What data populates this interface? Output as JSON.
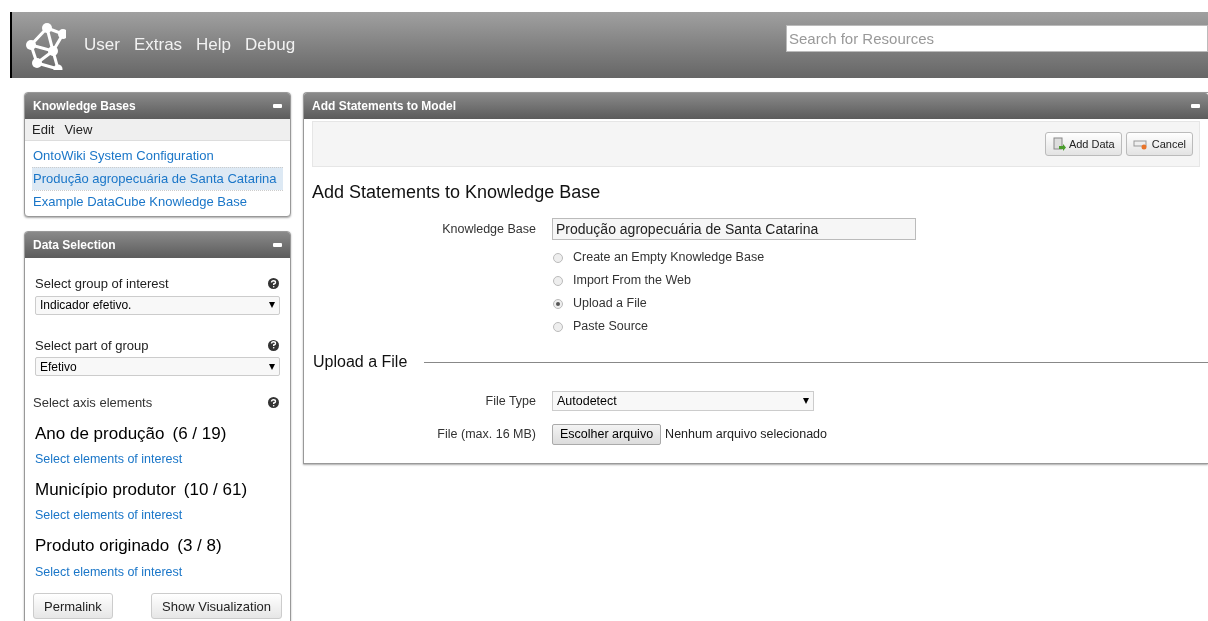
{
  "menu": [
    "User",
    "Extras",
    "Help",
    "Debug"
  ],
  "search": {
    "placeholder": "Search for Resources"
  },
  "kb_panel": {
    "title": "Knowledge Bases",
    "menu": [
      "Edit",
      "View"
    ],
    "items": [
      {
        "label": "OntoWiki System Configuration",
        "selected": false
      },
      {
        "label": "Produção agropecuária de Santa Catarina",
        "selected": true
      },
      {
        "label": "Example DataCube Knowledge Base",
        "selected": false
      }
    ]
  },
  "data_panel": {
    "title": "Data Selection",
    "selects": [
      {
        "label": "Select group of interest",
        "value": "Indicador efetivo."
      },
      {
        "label": "Select part of group",
        "value": "Efetivo"
      }
    ],
    "axis_label": "Select axis elements",
    "axes": [
      {
        "name": "Ano de produção",
        "count": "(6 / 19)",
        "link": "Select elements of interest"
      },
      {
        "name": "Município produtor",
        "count": "(10 / 61)",
        "link": "Select elements of interest"
      },
      {
        "name": "Produto originado",
        "count": "(3 / 8)",
        "link": "Select elements of interest"
      }
    ],
    "buttons": [
      "Permalink",
      "Show Visualization"
    ]
  },
  "main": {
    "title": "Add Statements to Model",
    "toolbar": [
      "Add Data",
      "Cancel"
    ],
    "heading": "Add Statements to Knowledge Base",
    "kb_label": "Knowledge Base",
    "kb_value": "Produção agropecuária de Santa Catarina",
    "options": [
      {
        "label": "Create an Empty Knowledge Base",
        "selected": false
      },
      {
        "label": "Import From the Web",
        "selected": false
      },
      {
        "label": "Upload a File",
        "selected": true
      },
      {
        "label": "Paste Source",
        "selected": false
      }
    ],
    "section": "Upload a File",
    "file_type_label": "File Type",
    "file_type_value": "Autodetect",
    "file_label": "File (max. 16 MB)",
    "file_button": "Escolher arquivo",
    "file_status": "Nenhum arquivo selecionado"
  }
}
